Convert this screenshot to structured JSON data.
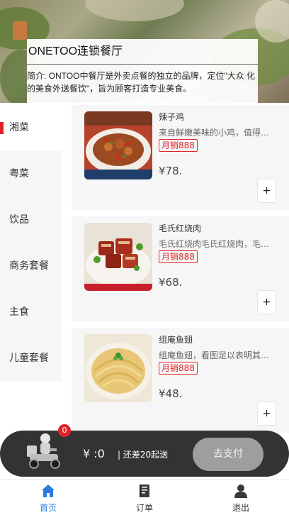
{
  "shop": {
    "name": "ONETOO连锁餐厅",
    "intro": "简介: ONTOO中餐厅是外卖点餐的独立的品牌，定位\"大众 化的美食外送餐饮\"，旨为顾客打造专业美食。"
  },
  "categories": [
    {
      "label": "湘菜",
      "active": true
    },
    {
      "label": "粤菜",
      "active": false
    },
    {
      "label": "饮品",
      "active": false
    },
    {
      "label": "商务套餐",
      "active": false
    },
    {
      "label": "主食",
      "active": false
    },
    {
      "label": "儿童套餐",
      "active": false
    }
  ],
  "dishes": [
    {
      "name": "辣子鸡",
      "desc": "来自鲜嫩美味的小鸡，值得一尝",
      "sales": "月销888",
      "price": "¥78.",
      "add": "+"
    },
    {
      "name": "毛氏红烧肉",
      "desc": "毛氏红烧肉毛氏红烧肉，毛氏红烧肉",
      "sales": "月销888",
      "price": "¥68.",
      "add": "+"
    },
    {
      "name": "组庵鱼翅",
      "desc": "组庵鱼翅，看图足以表明其美味",
      "sales": "月销888",
      "price": "¥48.",
      "add": "+"
    }
  ],
  "cart": {
    "badge": "0",
    "total": "¥ :0",
    "min_order": "| 还差20起送",
    "pay_label": "去支付"
  },
  "tabs": [
    {
      "label": "首页",
      "icon": "home-icon",
      "active": true
    },
    {
      "label": "订单",
      "icon": "order-icon",
      "active": false
    },
    {
      "label": "退出",
      "icon": "user-icon",
      "active": false
    }
  ],
  "colors": {
    "accent_red": "#e0242a",
    "tab_active": "#2f7be0",
    "cart_bar": "#333333",
    "pay_button": "#9e9e9e"
  }
}
